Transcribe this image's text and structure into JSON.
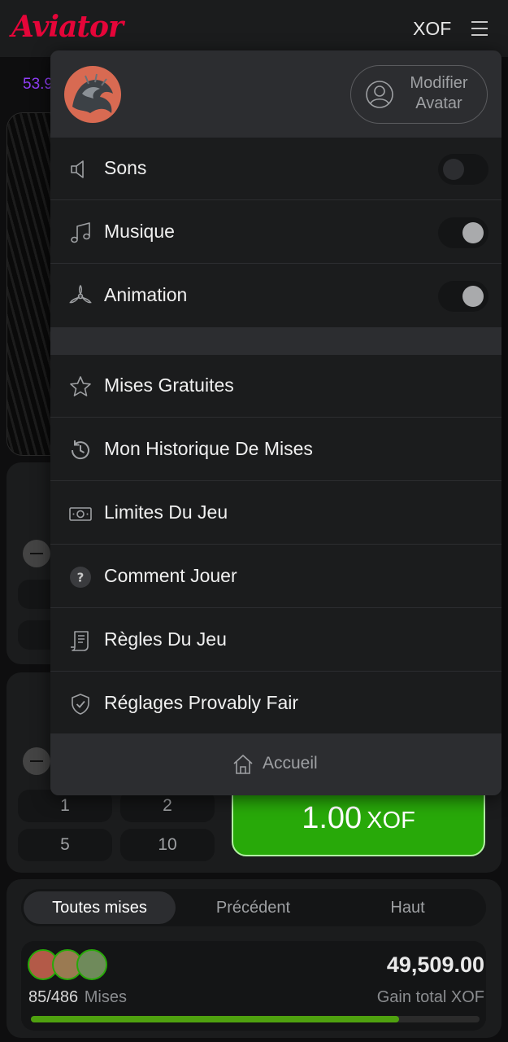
{
  "header": {
    "logo": "Aviator",
    "currency": "XOF"
  },
  "game": {
    "multiplier_partial": "53.9"
  },
  "bet_panel": {
    "quick_amounts": [
      "1",
      "2",
      "5",
      "10"
    ],
    "bet_amount": "1.00",
    "bet_currency": "XOF"
  },
  "menu": {
    "change_avatar_label": "Modifier Avatar",
    "settings": [
      {
        "label": "Sons",
        "icon": "speaker-icon",
        "enabled": false
      },
      {
        "label": "Musique",
        "icon": "music-note-icon",
        "enabled": true
      },
      {
        "label": "Animation",
        "icon": "propeller-icon",
        "enabled": true
      }
    ],
    "items": [
      {
        "label": "Mises Gratuites",
        "icon": "star-icon"
      },
      {
        "label": "Mon Historique De Mises",
        "icon": "history-icon"
      },
      {
        "label": "Limites Du Jeu",
        "icon": "banknote-icon"
      },
      {
        "label": "Comment Jouer",
        "icon": "help-circle-icon"
      },
      {
        "label": "Règles Du Jeu",
        "icon": "document-icon"
      },
      {
        "label": "Réglages Provably Fair",
        "icon": "shield-check-icon"
      }
    ],
    "home_label": "Accueil"
  },
  "bets": {
    "tabs": [
      "Toutes mises",
      "Précédent",
      "Haut"
    ],
    "active_tab": "Toutes mises",
    "count": "85/486",
    "count_label": "Mises",
    "total_amount": "49,509.00",
    "total_label": "Gain total XOF",
    "progress_fraction": 0.82
  },
  "colors": {
    "brand_red": "#e50539",
    "accent_green": "#28a909",
    "multiplier_purple": "#913ef8"
  }
}
